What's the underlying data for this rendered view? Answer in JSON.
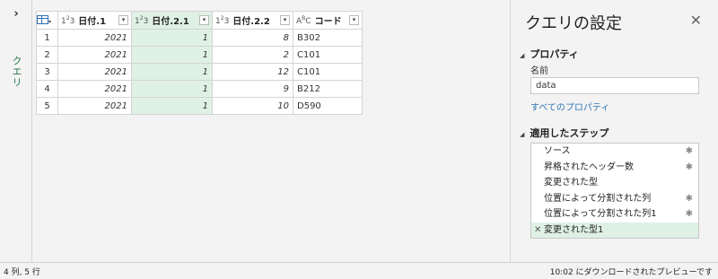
{
  "left_pane": {
    "toggle_glyph": "›",
    "vertical_label": "クエリ"
  },
  "grid": {
    "columns": [
      {
        "type_icon": "1²3",
        "label": "日付.1"
      },
      {
        "type_icon": "1²3",
        "label": "日付.2.1"
      },
      {
        "type_icon": "1²3",
        "label": "日付.2.2"
      },
      {
        "type_icon": "A^B_C",
        "label": "コード"
      }
    ],
    "dropdown_glyph": "▾",
    "rows": [
      {
        "n": "1",
        "c1": "2021",
        "c2": "1",
        "c3": "8",
        "c4": "B302"
      },
      {
        "n": "2",
        "c1": "2021",
        "c2": "1",
        "c3": "2",
        "c4": "C101"
      },
      {
        "n": "3",
        "c1": "2021",
        "c2": "1",
        "c3": "12",
        "c4": "C101"
      },
      {
        "n": "4",
        "c1": "2021",
        "c2": "1",
        "c3": "9",
        "c4": "B212"
      },
      {
        "n": "5",
        "c1": "2021",
        "c2": "1",
        "c3": "10",
        "c4": "D590"
      }
    ]
  },
  "settings": {
    "title": "クエリの設定",
    "close_glyph": "✕",
    "properties_header": "プロパティ",
    "name_label": "名前",
    "name_value": "data",
    "all_properties_link": "すべてのプロパティ",
    "steps_header": "適用したステップ",
    "collapse_glyph": "◢",
    "steps": [
      {
        "label": "ソース",
        "gear": "✱"
      },
      {
        "label": "昇格されたヘッダー数",
        "gear": "✱"
      },
      {
        "label": "変更された型",
        "gear": ""
      },
      {
        "label": "位置によって分割された列",
        "gear": "✱"
      },
      {
        "label": "位置によって分割された列1",
        "gear": "✱"
      },
      {
        "label": "変更された型1",
        "gear": ""
      }
    ],
    "active_step_delete_glyph": "✕"
  },
  "status": {
    "left": "4 列, 5 行",
    "right": "10:02 にダウンロードされたプレビューです"
  },
  "colors": {
    "selected_column": "#dff1e5",
    "accent_green": "#217346",
    "link_blue": "#2e75b6"
  }
}
